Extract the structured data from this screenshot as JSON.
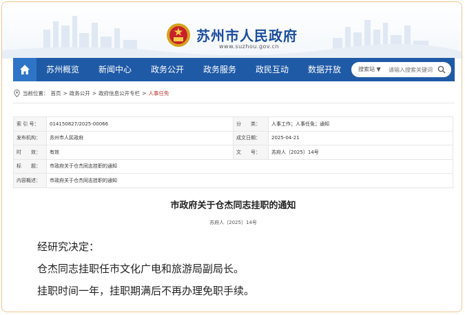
{
  "header": {
    "site_title": "苏州市人民政府",
    "site_url": "www.suzhou.gov.cn"
  },
  "nav": {
    "home_icon": "home-icon",
    "items": [
      "苏州概览",
      "新闻中心",
      "政务公开",
      "政务服务",
      "政民互动",
      "数据开放"
    ],
    "search": {
      "label": "搜索站 ▼",
      "placeholder": "请输入搜索关键词"
    }
  },
  "breadcrumb": {
    "prefix": "当前位置：",
    "items": [
      "首页",
      "政务公开",
      "政府信息公开专栏"
    ],
    "separator": ">",
    "current": "人事任免"
  },
  "meta": {
    "rows": [
      {
        "k1": "索 引 号：",
        "v1": "014150827/2025-00066",
        "k2": "分　　类：",
        "v2": "人事工作；人事任免；通知"
      },
      {
        "k1": "发布机构：",
        "v1": "苏州市人民政府",
        "k2": "成文日期：",
        "v2": "2025-04-21"
      },
      {
        "k1": "时　　效：",
        "v1": "有效",
        "k2": "文　　号：",
        "v2": "苏府人〔2025〕14号"
      }
    ],
    "title_label": "标　　题：",
    "title_value": "市政府关于仓杰同志挂职的通知",
    "summary_label": "内容概述：",
    "summary_value": "市政府关于仓杰同志挂职的通知"
  },
  "document": {
    "title": "市政府关于仓杰同志挂职的通知",
    "number": "苏府人〔2025〕14号",
    "lines": [
      "经研究决定：",
      "仓杰同志挂职任市文化广电和旅游局副局长。",
      "挂职时间一年，挂职期满后不再办理免职手续。"
    ]
  },
  "colors": {
    "nav_bg": "#1f5aa6",
    "brand_blue": "#1a4d9c",
    "accent_red": "#c0392b",
    "frame_border": "#f0c48e"
  }
}
